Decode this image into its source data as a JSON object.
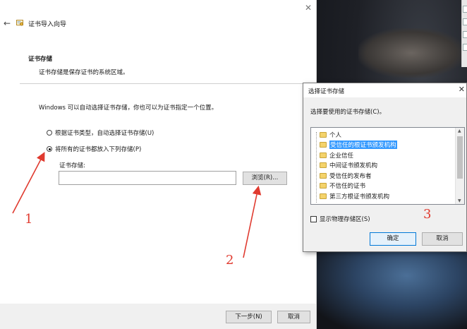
{
  "wizard": {
    "title": "证书导入向导",
    "section_heading": "证书存储",
    "section_subtitle": "证书存储是保存证书的系统区域。",
    "intro": "Windows 可以自动选择证书存储，你也可以为证书指定一个位置。",
    "radio_auto": "根据证书类型，自动选择证书存储(U)",
    "radio_manual": "将所有的证书都放入下列存储(P)",
    "store_label": "证书存储:",
    "store_value": "",
    "browse_label": "浏览(R)...",
    "next_label": "下一步(N)",
    "cancel_label": "取消",
    "close_glyph": "✕"
  },
  "dialog": {
    "title": "选择证书存储",
    "close_glyph": "✕",
    "prompt": "选择要使用的证书存储(C)。",
    "stores": [
      "个人",
      "受信任的根证书颁发机构",
      "企业信任",
      "中间证书颁发机构",
      "受信任的发布者",
      "不信任的证书",
      "第三方根证书颁发机构"
    ],
    "selected_index": 1,
    "show_physical_label": "显示物理存储区(S)",
    "ok_label": "确定",
    "cancel_label": "取消"
  },
  "annotations": [
    "1",
    "2",
    "3"
  ],
  "colors": {
    "annotation": "#e03a2f",
    "selection": "#3399ff",
    "folder": "#f4d36b"
  }
}
